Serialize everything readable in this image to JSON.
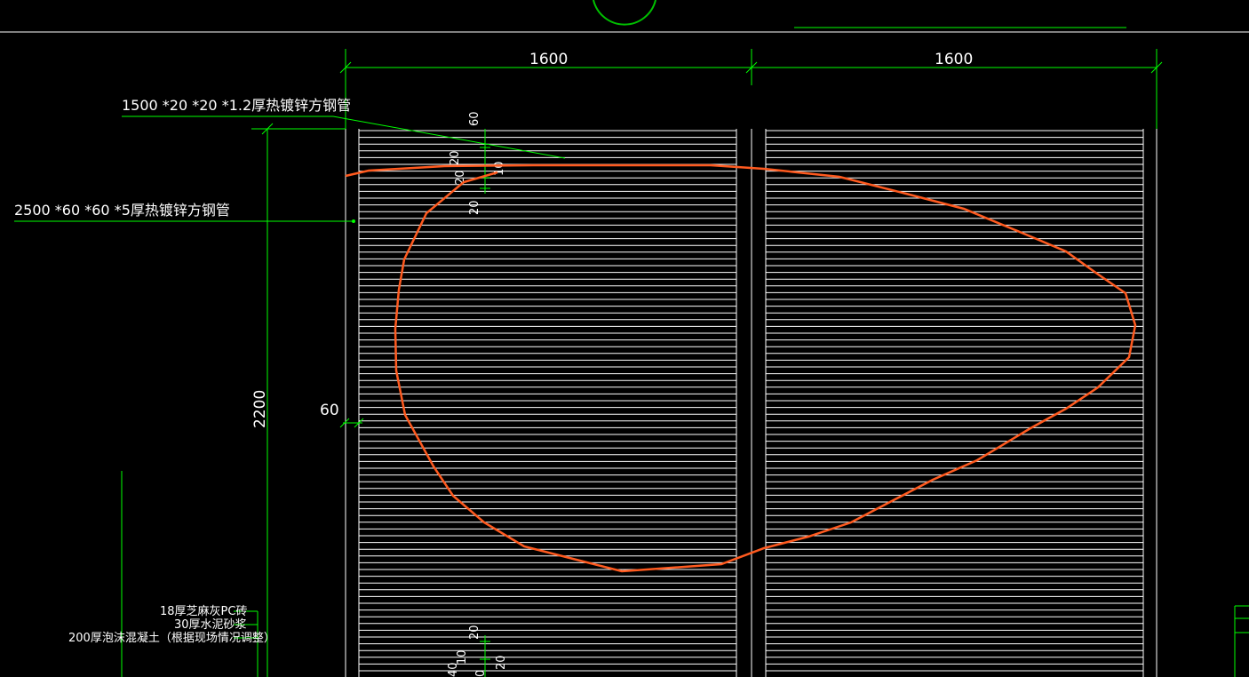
{
  "drawing": {
    "dimensions": {
      "top_left_width": "1600",
      "top_right_width": "1600",
      "left_height": "2200",
      "side_offset": "60",
      "small_60": "60",
      "small_10": "10",
      "small_20a": "20",
      "small_20b": "20",
      "small_20c": "20",
      "small_10b": "10",
      "small_20d": "20",
      "small_40": "40",
      "small_10c": "0"
    },
    "labels": {
      "pipe_small": "1500 *20 *20 *1.2厚热镀锌方钢管",
      "pipe_large": "2500 *60 *60 *5厚热镀锌方钢管",
      "layer_1": "18厚芝麻灰PC砖",
      "layer_2": "30厚水泥砂浆",
      "layer_3": "200厚泡沫混凝土（根据现场情况调整）"
    },
    "colors": {
      "background": "#000000",
      "dimension": "#00ff00",
      "geometry": "#ffffff",
      "outline": "#ff5a1f",
      "circle": "#00c000"
    }
  }
}
